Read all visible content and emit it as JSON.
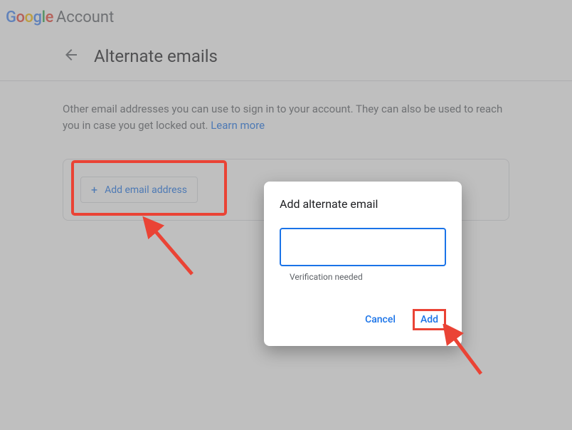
{
  "header": {
    "logo_text": "Google",
    "account_label": "Account"
  },
  "page": {
    "title": "Alternate emails",
    "description_part1": "Other email addresses you can use to sign in to your account. They can also be used to reach you in case you get locked out. ",
    "learn_more": "Learn more"
  },
  "card": {
    "add_email_label": "Add email address"
  },
  "dialog": {
    "title": "Add alternate email",
    "input_value": "",
    "helper_text": "Verification needed",
    "cancel_label": "Cancel",
    "add_label": "Add"
  }
}
